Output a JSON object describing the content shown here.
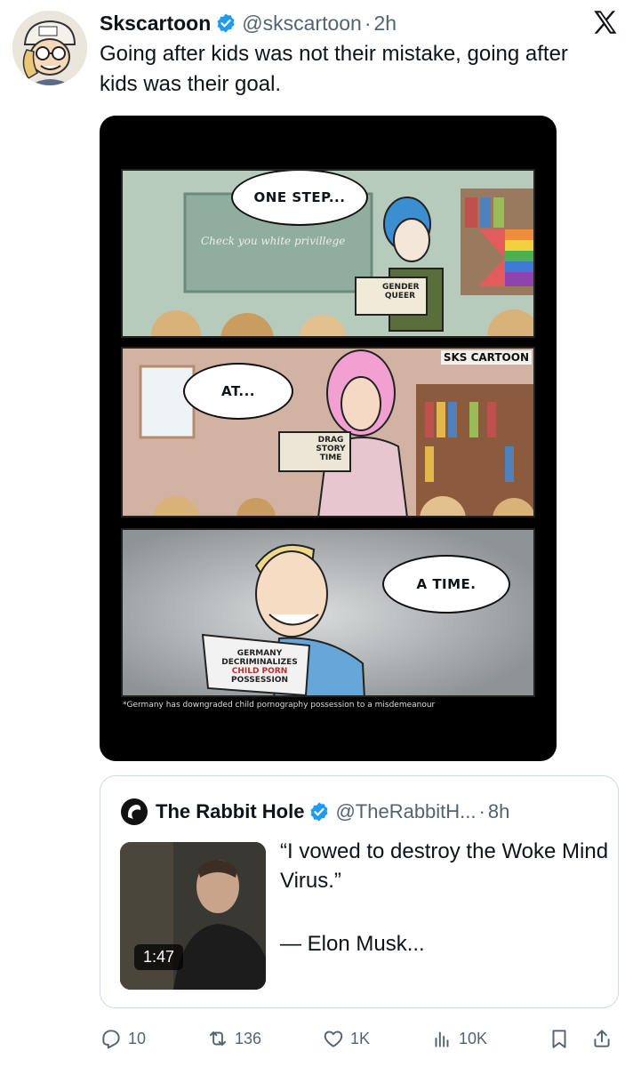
{
  "tweet": {
    "author_name": "Skscartoon",
    "handle": "@skscartoon",
    "separator": "·",
    "time": "2h",
    "text": "Going after kids was not their mistake, going after kids was their goal."
  },
  "comic": {
    "panel1": {
      "speech": "ONE STEP...",
      "chalkboard_text": "Check you white privillege",
      "book_line1": "GENDER",
      "book_line2": "QUEER"
    },
    "panel2": {
      "speech": "AT...",
      "watermark": "SKS CARTOON",
      "book_line1": "DRAG",
      "book_line2": "STORY",
      "book_line3": "TIME"
    },
    "panel3": {
      "speech": "A TIME.",
      "paper_line1": "GERMANY",
      "paper_line2": "DECRIMINALIZES",
      "paper_line3": "CHILD PORN",
      "paper_line4": "POSSESSION",
      "footnote": "*Germany has downgraded child pornography possession to a misdemeanour"
    }
  },
  "quote": {
    "author_name": "The Rabbit Hole",
    "handle": "@TheRabbitH...",
    "separator": "·",
    "time": "8h",
    "video_duration": "1:47",
    "text_line1": "“I vowed to destroy the Woke Mind Virus.”",
    "text_line2": "— Elon Musk..."
  },
  "actions": {
    "replies": "10",
    "reposts": "136",
    "likes": "1K",
    "views": "10K"
  },
  "colors": {
    "text": "#0f1419",
    "secondary": "#536471",
    "verified": "#1d9bf0",
    "border": "#cfd9de"
  }
}
